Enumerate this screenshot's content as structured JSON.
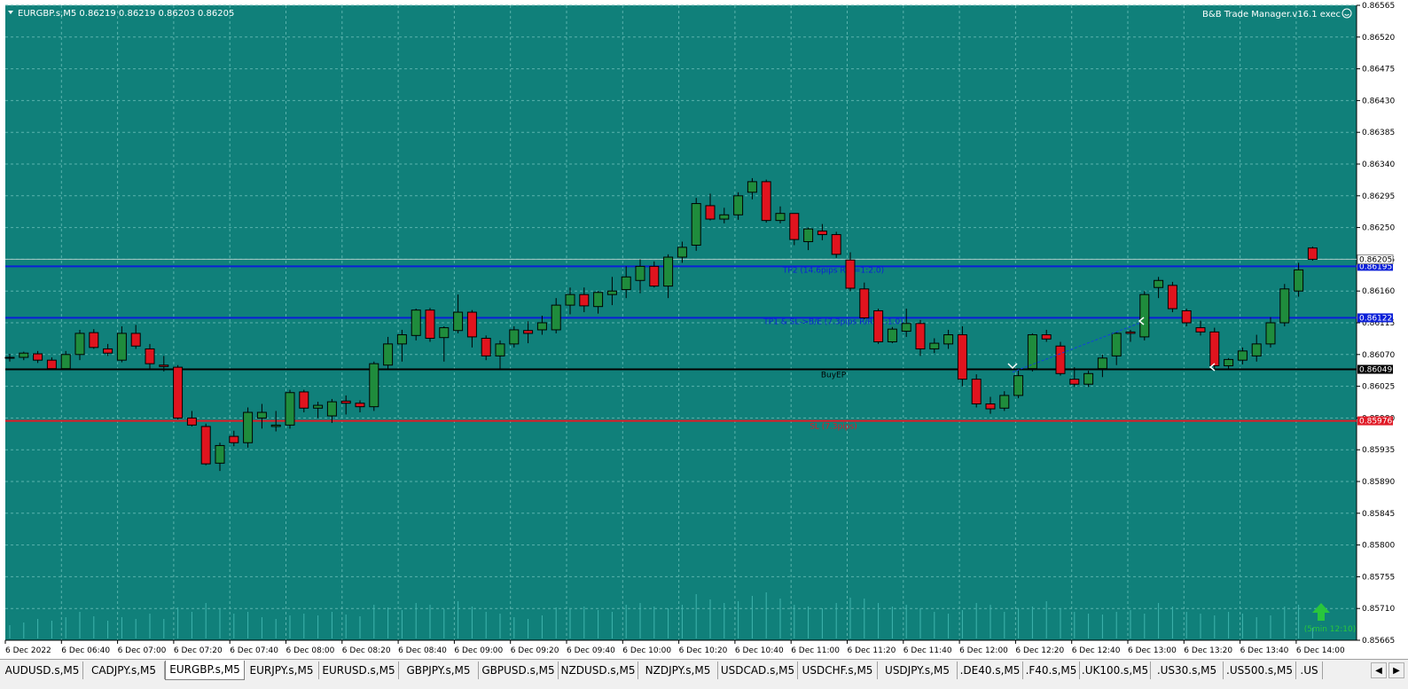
{
  "chart": {
    "symbol_header": "EURGBP.s,M5  0.86219 0.86219 0.86203 0.86205",
    "ea_label": "B&B Trade Manager.v16.1 exec",
    "smiley": "☺",
    "colors": {
      "background": "#10807a",
      "grid": "#5ab3ad",
      "bull": "#1f8c3c",
      "bear": "#e0141e",
      "tp_line": "#0b1fd8",
      "entry_line": "#000000",
      "sl_line": "#e01a26",
      "axis_text": "#000000"
    },
    "price_scale": [
      "0.86565",
      "0.86520",
      "0.86475",
      "0.86430",
      "0.86385",
      "0.86340",
      "0.86295",
      "0.86250",
      "0.86205",
      "0.86160",
      "0.86115",
      "0.86070",
      "0.86025",
      "0.85980",
      "0.85935",
      "0.85890",
      "0.85845",
      "0.85800",
      "0.85755",
      "0.85710",
      "0.85665"
    ],
    "time_labels": [
      "6 Dec 2022",
      "6 Dec 06:40",
      "6 Dec 07:00",
      "6 Dec 07:20",
      "6 Dec 07:40",
      "6 Dec 08:00",
      "6 Dec 08:20",
      "6 Dec 08:40",
      "6 Dec 09:00",
      "6 Dec 09:20",
      "6 Dec 09:40",
      "6 Dec 10:00",
      "6 Dec 10:20",
      "6 Dec 10:40",
      "6 Dec 11:00",
      "6 Dec 11:20",
      "6 Dec 11:40",
      "6 Dec 12:00",
      "6 Dec 12:20",
      "6 Dec 12:40",
      "6 Dec 13:00",
      "6 Dec 13:20",
      "6 Dec 13:40",
      "6 Dec 14:00"
    ],
    "levels": {
      "tp2": {
        "price": 0.86195,
        "badge": "0.86195",
        "label": "TP2 (14.6pips R/R=1:2.0)"
      },
      "tp1": {
        "price": 0.86122,
        "badge": "0.86122",
        "label": "TP1 & SL->B/E (7.3pips R/R=1:1.0)"
      },
      "entry": {
        "price": 0.86049,
        "badge": "0.86049",
        "label": "BuyEP"
      },
      "sl": {
        "price": 0.85976,
        "badge": "0.85976",
        "label": "SL (7.3pips)"
      },
      "current_badge": "0.86205"
    },
    "timer_text": "(5min 12:10)",
    "candles": [
      [
        0.86065,
        0.86071,
        0.8606,
        0.86066
      ],
      [
        0.86066,
        0.86074,
        0.86062,
        0.86072
      ],
      [
        0.86071,
        0.86075,
        0.86058,
        0.86062
      ],
      [
        0.86062,
        0.86066,
        0.86048,
        0.8605
      ],
      [
        0.8605,
        0.86075,
        0.86048,
        0.8607
      ],
      [
        0.8607,
        0.86105,
        0.86062,
        0.861
      ],
      [
        0.86101,
        0.86106,
        0.86078,
        0.8608
      ],
      [
        0.86078,
        0.86085,
        0.86068,
        0.86072
      ],
      [
        0.86062,
        0.8611,
        0.86059,
        0.861
      ],
      [
        0.861,
        0.86112,
        0.86078,
        0.86082
      ],
      [
        0.86078,
        0.86085,
        0.8605,
        0.86057
      ],
      [
        0.86055,
        0.86068,
        0.86046,
        0.86053
      ],
      [
        0.86052,
        0.86055,
        0.85978,
        0.8598
      ],
      [
        0.8598,
        0.8599,
        0.85968,
        0.8597
      ],
      [
        0.85968,
        0.85972,
        0.85913,
        0.85915
      ],
      [
        0.85916,
        0.85945,
        0.85905,
        0.85941
      ],
      [
        0.85954,
        0.85962,
        0.8594,
        0.85945
      ],
      [
        0.85945,
        0.85995,
        0.85938,
        0.85988
      ],
      [
        0.8598,
        0.86,
        0.85965,
        0.85988
      ],
      [
        0.85968,
        0.8599,
        0.85961,
        0.8597
      ],
      [
        0.8597,
        0.8602,
        0.85965,
        0.86016
      ],
      [
        0.86017,
        0.8602,
        0.85988,
        0.85994
      ],
      [
        0.85994,
        0.86003,
        0.8598,
        0.85998
      ],
      [
        0.85983,
        0.86007,
        0.85973,
        0.86003
      ],
      [
        0.86004,
        0.86012,
        0.85985,
        0.86001
      ],
      [
        0.86001,
        0.86005,
        0.85988,
        0.85996
      ],
      [
        0.85996,
        0.8606,
        0.8599,
        0.86057
      ],
      [
        0.86055,
        0.86095,
        0.8605,
        0.86085
      ],
      [
        0.86085,
        0.86105,
        0.8606,
        0.86098
      ],
      [
        0.86097,
        0.86135,
        0.8609,
        0.86133
      ],
      [
        0.86133,
        0.86136,
        0.86088,
        0.86093
      ],
      [
        0.86094,
        0.8611,
        0.8606,
        0.86108
      ],
      [
        0.86104,
        0.86155,
        0.861,
        0.8613
      ],
      [
        0.8613,
        0.86133,
        0.8608,
        0.86095
      ],
      [
        0.86093,
        0.86097,
        0.86062,
        0.86068
      ],
      [
        0.86068,
        0.8609,
        0.8605,
        0.86085
      ],
      [
        0.86085,
        0.8611,
        0.8608,
        0.86105
      ],
      [
        0.86104,
        0.86117,
        0.86086,
        0.861
      ],
      [
        0.86105,
        0.86125,
        0.86098,
        0.86115
      ],
      [
        0.86105,
        0.8615,
        0.861,
        0.8614
      ],
      [
        0.8614,
        0.86165,
        0.86127,
        0.86155
      ],
      [
        0.86155,
        0.86165,
        0.8613,
        0.86139
      ],
      [
        0.86138,
        0.8616,
        0.86128,
        0.86158
      ],
      [
        0.86155,
        0.8618,
        0.8614,
        0.8616
      ],
      [
        0.86162,
        0.86195,
        0.8615,
        0.8618
      ],
      [
        0.86175,
        0.86205,
        0.86157,
        0.86195
      ],
      [
        0.86195,
        0.86202,
        0.86165,
        0.86167
      ],
      [
        0.86167,
        0.86212,
        0.8615,
        0.86208
      ],
      [
        0.86208,
        0.8623,
        0.862,
        0.86222
      ],
      [
        0.86225,
        0.86292,
        0.86217,
        0.86284
      ],
      [
        0.86281,
        0.86298,
        0.8626,
        0.86262
      ],
      [
        0.86262,
        0.86278,
        0.86256,
        0.86268
      ],
      [
        0.86268,
        0.863,
        0.86261,
        0.86295
      ],
      [
        0.863,
        0.8632,
        0.8629,
        0.86315
      ],
      [
        0.86315,
        0.86318,
        0.86257,
        0.8626
      ],
      [
        0.8626,
        0.8628,
        0.86256,
        0.8627
      ],
      [
        0.8627,
        0.8627,
        0.86225,
        0.86233
      ],
      [
        0.8623,
        0.8625,
        0.86218,
        0.86248
      ],
      [
        0.86245,
        0.86255,
        0.86232,
        0.8624
      ],
      [
        0.8624,
        0.86244,
        0.86207,
        0.86212
      ],
      [
        0.86204,
        0.86215,
        0.8616,
        0.86164
      ],
      [
        0.86163,
        0.86172,
        0.8612,
        0.86122
      ],
      [
        0.86132,
        0.86135,
        0.86085,
        0.86088
      ],
      [
        0.86088,
        0.86109,
        0.86086,
        0.86106
      ],
      [
        0.86103,
        0.86135,
        0.86095,
        0.86114
      ],
      [
        0.86114,
        0.86119,
        0.86068,
        0.86078
      ],
      [
        0.86078,
        0.86093,
        0.86072,
        0.86086
      ],
      [
        0.86085,
        0.86105,
        0.86078,
        0.86098
      ],
      [
        0.86098,
        0.8611,
        0.86025,
        0.86035
      ],
      [
        0.86035,
        0.86042,
        0.85995,
        0.86
      ],
      [
        0.86,
        0.8601,
        0.85986,
        0.85993
      ],
      [
        0.85994,
        0.86018,
        0.8599,
        0.86012
      ],
      [
        0.86012,
        0.86048,
        0.86008,
        0.8604
      ],
      [
        0.8605,
        0.861,
        0.86046,
        0.86098
      ],
      [
        0.86098,
        0.86105,
        0.86088,
        0.86092
      ],
      [
        0.86082,
        0.86088,
        0.8604,
        0.86043
      ],
      [
        0.86035,
        0.86052,
        0.86024,
        0.86028
      ],
      [
        0.86028,
        0.86047,
        0.86024,
        0.86043
      ],
      [
        0.8605,
        0.8607,
        0.86038,
        0.86065
      ],
      [
        0.86068,
        0.86102,
        0.86055,
        0.861
      ],
      [
        0.86102,
        0.86105,
        0.86088,
        0.861
      ],
      [
        0.86095,
        0.8616,
        0.8609,
        0.86155
      ],
      [
        0.86165,
        0.8618,
        0.8615,
        0.86175
      ],
      [
        0.86168,
        0.86173,
        0.8613,
        0.86135
      ],
      [
        0.86132,
        0.86135,
        0.8611,
        0.86115
      ],
      [
        0.86108,
        0.86118,
        0.86097,
        0.86102
      ],
      [
        0.86102,
        0.86108,
        0.86049,
        0.86054
      ],
      [
        0.86054,
        0.86065,
        0.86048,
        0.86063
      ],
      [
        0.86062,
        0.8608,
        0.86056,
        0.86075
      ],
      [
        0.86068,
        0.86098,
        0.8606,
        0.86085
      ],
      [
        0.86085,
        0.86123,
        0.8608,
        0.86115
      ],
      [
        0.86115,
        0.8617,
        0.8611,
        0.86163
      ],
      [
        0.8616,
        0.862,
        0.86152,
        0.8619
      ],
      [
        0.86221,
        0.86223,
        0.86203,
        0.86205
      ]
    ],
    "volumes": [
      15,
      18,
      22,
      20,
      24,
      30,
      25,
      20,
      24,
      22,
      28,
      22,
      35,
      30,
      40,
      33,
      28,
      30,
      24,
      22,
      26,
      28,
      26,
      30,
      27,
      25,
      38,
      35,
      32,
      40,
      38,
      33,
      42,
      36,
      30,
      28,
      24,
      22,
      26,
      35,
      33,
      36,
      32,
      30,
      38,
      40,
      36,
      34,
      38,
      50,
      44,
      40,
      42,
      48,
      52,
      45,
      38,
      36,
      34,
      40,
      46,
      45,
      40,
      36,
      38,
      34,
      30,
      28,
      32,
      40,
      38,
      30,
      34,
      36,
      42,
      34,
      30,
      28,
      27,
      30,
      32,
      28,
      40,
      36,
      30,
      28,
      26,
      30,
      28,
      24,
      26,
      36,
      38,
      12
    ]
  },
  "tabs": [
    "AUDUSD.s,M5",
    "CADJPY.s,M5",
    "EURGBP.s,M5",
    "EURJPY.s,M5",
    "EURUSD.s,M5",
    "GBPJPY.s,M5",
    "GBPUSD.s,M5",
    "NZDUSD.s,M5",
    "NZDJPY.s,M5",
    "USDCAD.s,M5",
    "USDCHF.s,M5",
    "USDJPY.s,M5",
    ".DE40.s,M5",
    ".F40.s,M5",
    ".UK100.s,M5",
    ".US30.s,M5",
    ".US500.s,M5",
    ".US"
  ],
  "active_tab": "EURGBP.s,M5",
  "tab_scroll": {
    "left": "◀",
    "right": "▶"
  }
}
